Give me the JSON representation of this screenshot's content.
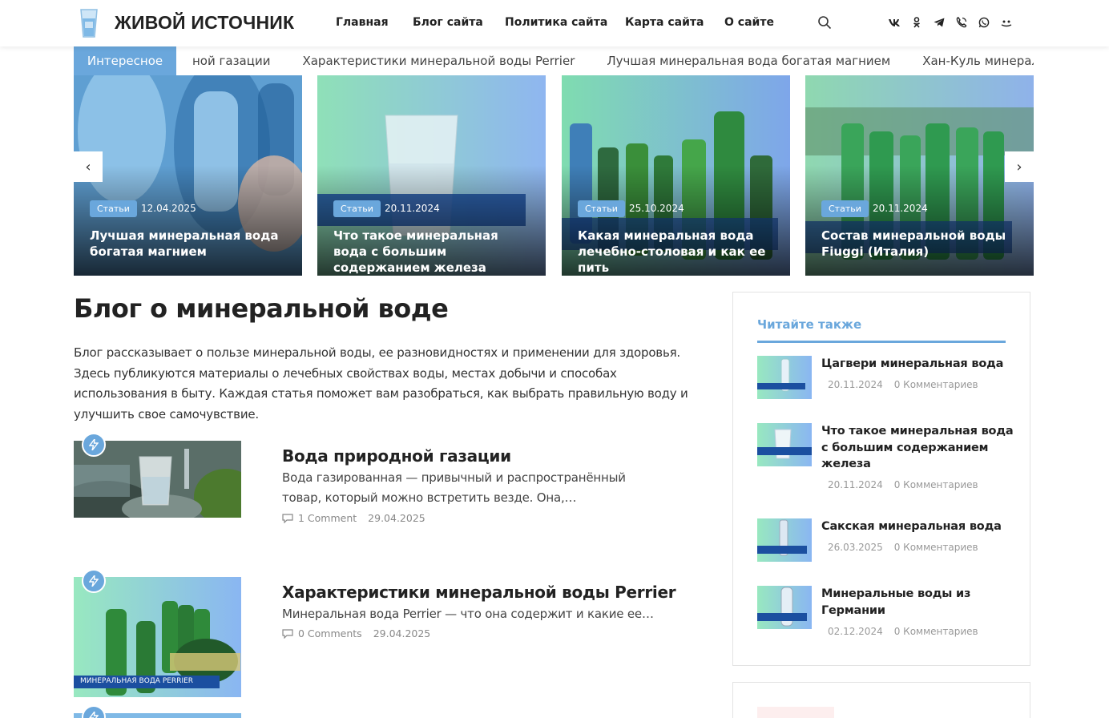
{
  "site": {
    "name": "ЖИВОЙ ИСТОЧНИК",
    "nav": [
      "Главная",
      "Блог сайта",
      "Политика сайта",
      "Карта сайта",
      "О сайте"
    ],
    "social_icons": [
      "vk-icon",
      "odnoklassniki-icon",
      "telegram-icon",
      "viber-icon",
      "whatsapp-icon",
      "user-icon"
    ],
    "social_glyphs": [
      "vk",
      "ok",
      "tg",
      "vb",
      "wa",
      "ru"
    ]
  },
  "ticker": {
    "label": "Интересное",
    "items": [
      "ной газации",
      "Характеристики минеральной воды Perrier",
      "Лучшая минеральная вода богатая магнием",
      "Хан-Куль минеральная вода"
    ]
  },
  "slider": {
    "prev": "‹",
    "next": "›",
    "slides": [
      {
        "category": "Статьи",
        "date": "12.04.2025",
        "title": "Лучшая минеральная вода богатая магнием"
      },
      {
        "category": "Статьи",
        "date": "20.11.2024",
        "title": "Что такое минеральная вода с большим содержанием железа"
      },
      {
        "category": "Статьи",
        "date": "25.10.2024",
        "title": "Какая минеральная вода лечебно-столовая и как ее пить"
      },
      {
        "category": "Статьи",
        "date": "20.11.2024",
        "title": "Состав минеральной воды Fiuggi (Италия)"
      }
    ]
  },
  "main": {
    "title": "Блог о минеральной воде",
    "intro": "Блог рассказывает о пользе минеральной воды, ее разновидностях и применении для здоровья. Здесь публикуются материалы о лечебных свойствах воды, местах добычи и способах использования в быту. Каждая статья поможет вам разобраться, как выбрать правильную воду и улучшить свое самочувствие.",
    "posts": [
      {
        "title": "Вода природной газации",
        "excerpt": "Вода газированная — привычный и распространённый товар, который можно встретить везде. Она,…",
        "comments": "1 Comment",
        "date": "29.04.2025"
      },
      {
        "title": "Характеристики минеральной воды Perrier",
        "excerpt": "Минеральная вода Perrier — что она содержит и какие ее…",
        "comments": "0 Comments",
        "date": "29.04.2025",
        "thumb_caption": "МИНЕРАЛЬНАЯ ВОДА PERRIER"
      }
    ]
  },
  "sidebar": {
    "title": "Читайте также",
    "items": [
      {
        "title": "Цагвери минеральная вода",
        "date": "20.11.2024",
        "comments": "0 Комментариев"
      },
      {
        "title": "Что такое минеральная вода с большим содержанием железа",
        "date": "20.11.2024",
        "comments": "0 Комментариев"
      },
      {
        "title": "Сакская минеральная вода",
        "date": "26.03.2025",
        "comments": "0 Комментариев"
      },
      {
        "title": "Минеральные воды из Германии",
        "date": "02.12.2024",
        "comments": "0 Комментариев"
      }
    ]
  },
  "colors": {
    "accent": "#6aa7dc",
    "text": "#222222",
    "muted": "#888888"
  }
}
